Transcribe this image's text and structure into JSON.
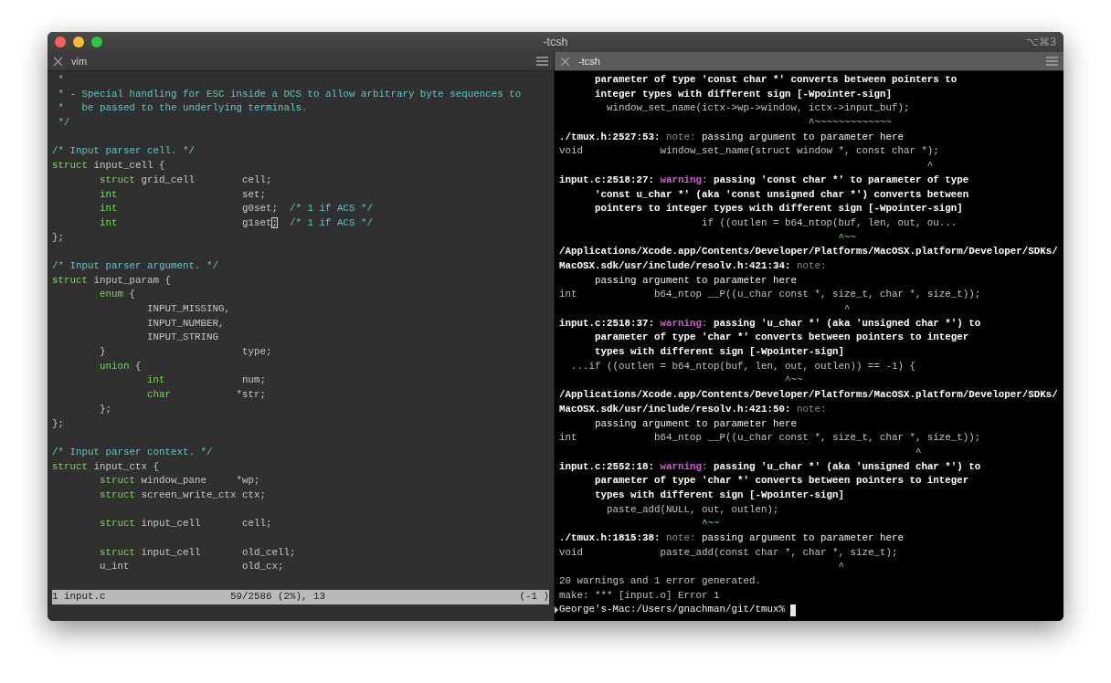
{
  "window": {
    "title": "-tcsh",
    "shortcut": "⌥⌘3"
  },
  "panes": [
    {
      "kind": "editor",
      "tab": {
        "title": "vim"
      },
      "lines": [
        {
          "kind": "text",
          "segments": [
            {
              "text": " *",
              "kind": "comment"
            }
          ]
        },
        {
          "kind": "text",
          "segments": [
            {
              "text": " * - Special handling for ESC inside a DCS to allow arbitrary byte sequences to",
              "kind": "comment"
            }
          ]
        },
        {
          "kind": "text",
          "segments": [
            {
              "text": " *   be passed to the underlying terminals.",
              "kind": "comment"
            }
          ]
        },
        {
          "kind": "text",
          "segments": [
            {
              "text": " */",
              "kind": "comment"
            }
          ]
        },
        {
          "kind": "blank"
        },
        {
          "kind": "text",
          "segments": [
            {
              "text": "/* Input parser cell. */",
              "kind": "comment"
            }
          ]
        },
        {
          "kind": "text",
          "segments": [
            {
              "text": "struct",
              "kind": "keyword"
            },
            {
              "text": " input_cell {",
              "kind": "plain"
            }
          ]
        },
        {
          "kind": "text",
          "segments": [
            {
              "text": "        struct",
              "kind": "keyword"
            },
            {
              "text": " grid_cell        cell;",
              "kind": "plain"
            }
          ]
        },
        {
          "kind": "text",
          "segments": [
            {
              "text": "        int",
              "kind": "keyword"
            },
            {
              "text": "                     set;",
              "kind": "plain"
            }
          ]
        },
        {
          "kind": "text",
          "segments": [
            {
              "text": "        int",
              "kind": "keyword"
            },
            {
              "text": "                     g0set;",
              "kind": "plain"
            },
            {
              "text": "  /* 1 if ACS */",
              "kind": "comment"
            }
          ]
        },
        {
          "kind": "text",
          "segments": [
            {
              "text": "        int",
              "kind": "keyword"
            },
            {
              "text": "                     g1set",
              "kind": "plain"
            },
            {
              "text": ";",
              "kind": "cursor"
            },
            {
              "text": "  /* 1 if ACS */",
              "kind": "comment"
            }
          ]
        },
        {
          "kind": "text",
          "segments": [
            {
              "text": "};",
              "kind": "plain"
            }
          ]
        },
        {
          "kind": "blank"
        },
        {
          "kind": "text",
          "segments": [
            {
              "text": "/* Input parser argument. */",
              "kind": "comment"
            }
          ]
        },
        {
          "kind": "text",
          "segments": [
            {
              "text": "struct",
              "kind": "keyword"
            },
            {
              "text": " input_param {",
              "kind": "plain"
            }
          ]
        },
        {
          "kind": "text",
          "segments": [
            {
              "text": "        enum",
              "kind": "keyword"
            },
            {
              "text": " {",
              "kind": "plain"
            }
          ]
        },
        {
          "kind": "text",
          "segments": [
            {
              "text": "                INPUT_MISSING,",
              "kind": "plain"
            }
          ]
        },
        {
          "kind": "text",
          "segments": [
            {
              "text": "                INPUT_NUMBER,",
              "kind": "plain"
            }
          ]
        },
        {
          "kind": "text",
          "segments": [
            {
              "text": "                INPUT_STRING",
              "kind": "plain"
            }
          ]
        },
        {
          "kind": "text",
          "segments": [
            {
              "text": "        }                       type;",
              "kind": "plain"
            }
          ]
        },
        {
          "kind": "text",
          "segments": [
            {
              "text": "        union",
              "kind": "keyword"
            },
            {
              "text": " {",
              "kind": "plain"
            }
          ]
        },
        {
          "kind": "text",
          "segments": [
            {
              "text": "                int",
              "kind": "keyword"
            },
            {
              "text": "             num;",
              "kind": "plain"
            }
          ]
        },
        {
          "kind": "text",
          "segments": [
            {
              "text": "                char",
              "kind": "keyword"
            },
            {
              "text": "           *str;",
              "kind": "plain"
            }
          ]
        },
        {
          "kind": "text",
          "segments": [
            {
              "text": "        };",
              "kind": "plain"
            }
          ]
        },
        {
          "kind": "text",
          "segments": [
            {
              "text": "};",
              "kind": "plain"
            }
          ]
        },
        {
          "kind": "blank"
        },
        {
          "kind": "text",
          "segments": [
            {
              "text": "/* Input parser context. */",
              "kind": "comment"
            }
          ]
        },
        {
          "kind": "text",
          "segments": [
            {
              "text": "struct",
              "kind": "keyword"
            },
            {
              "text": " input_ctx {",
              "kind": "plain"
            }
          ]
        },
        {
          "kind": "text",
          "segments": [
            {
              "text": "        struct",
              "kind": "keyword"
            },
            {
              "text": " window_pane     *wp;",
              "kind": "plain"
            }
          ]
        },
        {
          "kind": "text",
          "segments": [
            {
              "text": "        struct",
              "kind": "keyword"
            },
            {
              "text": " screen_write_ctx ctx;",
              "kind": "plain"
            }
          ]
        },
        {
          "kind": "blank"
        },
        {
          "kind": "text",
          "segments": [
            {
              "text": "        struct",
              "kind": "keyword"
            },
            {
              "text": " input_cell       cell;",
              "kind": "plain"
            }
          ]
        },
        {
          "kind": "blank"
        },
        {
          "kind": "text",
          "segments": [
            {
              "text": "        struct",
              "kind": "keyword"
            },
            {
              "text": " input_cell       old_cell;",
              "kind": "plain"
            }
          ]
        },
        {
          "kind": "text",
          "segments": [
            {
              "text": "        u_int                   old_cx;",
              "kind": "plain"
            }
          ]
        }
      ],
      "status": {
        "file": "1 input.c",
        "position": "59/2586 (2%), 13",
        "extra": "(-1 )"
      }
    },
    {
      "kind": "terminal",
      "tab": {
        "title": "-tcsh"
      },
      "lines": [
        {
          "kind": "text",
          "segments": [
            {
              "text": "      parameter of type 'const char *' converts between pointers to",
              "kind": "bold"
            }
          ]
        },
        {
          "kind": "text",
          "segments": [
            {
              "text": "      integer types with different sign [-Wpointer-sign]",
              "kind": "bold"
            }
          ]
        },
        {
          "kind": "text",
          "segments": [
            {
              "text": "        window_set_name(ictx->wp->window, ictx->input_buf);",
              "kind": "plain"
            }
          ]
        },
        {
          "kind": "text",
          "segments": [
            {
              "text": "                                          ^~~~~~~~~~~~~~",
              "kind": "caret"
            }
          ]
        },
        {
          "kind": "text",
          "segments": [
            {
              "text": "./tmux.h:2527:53: ",
              "kind": "bold"
            },
            {
              "text": "note:",
              "kind": "note"
            },
            {
              "text": " passing argument to parameter here",
              "kind": "message"
            }
          ]
        },
        {
          "kind": "text",
          "segments": [
            {
              "text": "void             window_set_name(struct window *, const char *);",
              "kind": "plain"
            }
          ]
        },
        {
          "kind": "text",
          "segments": [
            {
              "text": "                                                              ^",
              "kind": "caret"
            }
          ]
        },
        {
          "kind": "text",
          "segments": [
            {
              "text": "input.c:2518:27: ",
              "kind": "bold"
            },
            {
              "text": "warning:",
              "kind": "warning"
            },
            {
              "text": " passing 'const char *' to parameter of type",
              "kind": "bold"
            }
          ]
        },
        {
          "kind": "text",
          "segments": [
            {
              "text": "      'const u_char *' (aka 'const unsigned char *') converts between",
              "kind": "bold"
            }
          ]
        },
        {
          "kind": "text",
          "segments": [
            {
              "text": "      pointers to integer types with different sign [-Wpointer-sign]",
              "kind": "bold"
            }
          ]
        },
        {
          "kind": "text",
          "segments": [
            {
              "text": "                        if ((outlen = b64_ntop(buf, len, out, ou...",
              "kind": "plain"
            }
          ]
        },
        {
          "kind": "text",
          "segments": [
            {
              "text": "                                               ^~~",
              "kind": "caret"
            }
          ]
        },
        {
          "kind": "text",
          "segments": [
            {
              "text": "/Applications/Xcode.app/Contents/Developer/Platforms/MacOSX.platform/Developer/SDKs/",
              "kind": "bold"
            }
          ]
        },
        {
          "kind": "text",
          "segments": [
            {
              "text": "MacOSX.sdk/usr/include/resolv.h:421:34: ",
              "kind": "bold"
            },
            {
              "text": "note:",
              "kind": "note"
            }
          ]
        },
        {
          "kind": "text",
          "segments": [
            {
              "text": "      passing argument to parameter here",
              "kind": "message"
            }
          ]
        },
        {
          "kind": "text",
          "segments": [
            {
              "text": "int             b64_ntop __P((u_char const *, size_t, char *, size_t));",
              "kind": "plain"
            }
          ]
        },
        {
          "kind": "text",
          "segments": [
            {
              "text": "                                                ^",
              "kind": "caret"
            }
          ]
        },
        {
          "kind": "text",
          "segments": [
            {
              "text": "input.c:2518:37: ",
              "kind": "bold"
            },
            {
              "text": "warning:",
              "kind": "warning"
            },
            {
              "text": " passing 'u_char *' (aka 'unsigned char *') to",
              "kind": "bold"
            }
          ]
        },
        {
          "kind": "text",
          "segments": [
            {
              "text": "      parameter of type 'char *' converts between pointers to integer",
              "kind": "bold"
            }
          ]
        },
        {
          "kind": "text",
          "segments": [
            {
              "text": "      types with different sign [-Wpointer-sign]",
              "kind": "bold"
            }
          ]
        },
        {
          "kind": "text",
          "segments": [
            {
              "text": "  ...if ((outlen = b64_ntop(buf, len, out, outlen)) == -1) {",
              "kind": "plain"
            }
          ]
        },
        {
          "kind": "text",
          "segments": [
            {
              "text": "                                      ^~~",
              "kind": "caret"
            }
          ]
        },
        {
          "kind": "text",
          "segments": [
            {
              "text": "/Applications/Xcode.app/Contents/Developer/Platforms/MacOSX.platform/Developer/SDKs/",
              "kind": "bold"
            }
          ]
        },
        {
          "kind": "text",
          "segments": [
            {
              "text": "MacOSX.sdk/usr/include/resolv.h:421:50: ",
              "kind": "bold"
            },
            {
              "text": "note:",
              "kind": "note"
            }
          ]
        },
        {
          "kind": "text",
          "segments": [
            {
              "text": "      passing argument to parameter here",
              "kind": "message"
            }
          ]
        },
        {
          "kind": "text",
          "segments": [
            {
              "text": "int             b64_ntop __P((u_char const *, size_t, char *, size_t));",
              "kind": "plain"
            }
          ]
        },
        {
          "kind": "text",
          "segments": [
            {
              "text": "                                                            ^",
              "kind": "caret"
            }
          ]
        },
        {
          "kind": "text",
          "segments": [
            {
              "text": "input.c:2552:18: ",
              "kind": "bold"
            },
            {
              "text": "warning:",
              "kind": "warning"
            },
            {
              "text": " passing 'u_char *' (aka 'unsigned char *') to",
              "kind": "bold"
            }
          ]
        },
        {
          "kind": "text",
          "segments": [
            {
              "text": "      parameter of type 'char *' converts between pointers to integer",
              "kind": "bold"
            }
          ]
        },
        {
          "kind": "text",
          "segments": [
            {
              "text": "      types with different sign [-Wpointer-sign]",
              "kind": "bold"
            }
          ]
        },
        {
          "kind": "text",
          "segments": [
            {
              "text": "        paste_add(NULL, out, outlen);",
              "kind": "plain"
            }
          ]
        },
        {
          "kind": "text",
          "segments": [
            {
              "text": "                        ^~~",
              "kind": "caret"
            }
          ]
        },
        {
          "kind": "text",
          "segments": [
            {
              "text": "./tmux.h:1815:38: ",
              "kind": "bold"
            },
            {
              "text": "note:",
              "kind": "note"
            },
            {
              "text": " passing argument to parameter here",
              "kind": "message"
            }
          ]
        },
        {
          "kind": "text",
          "segments": [
            {
              "text": "void             paste_add(const char *, char *, size_t);",
              "kind": "plain"
            }
          ]
        },
        {
          "kind": "text",
          "segments": [
            {
              "text": "                                               ^",
              "kind": "caret"
            }
          ]
        },
        {
          "kind": "text",
          "segments": [
            {
              "text": "20 warnings and 1 error generated.",
              "kind": "plain"
            }
          ]
        },
        {
          "kind": "text",
          "segments": [
            {
              "text": "make: *** [input.o] Error 1",
              "kind": "plain"
            }
          ]
        },
        {
          "kind": "prompt",
          "mark": true,
          "cursor": true,
          "segments": [
            {
              "text": "George's-Mac:/Users/gnachman/git/tmux% ",
              "kind": "message"
            }
          ]
        }
      ]
    }
  ]
}
